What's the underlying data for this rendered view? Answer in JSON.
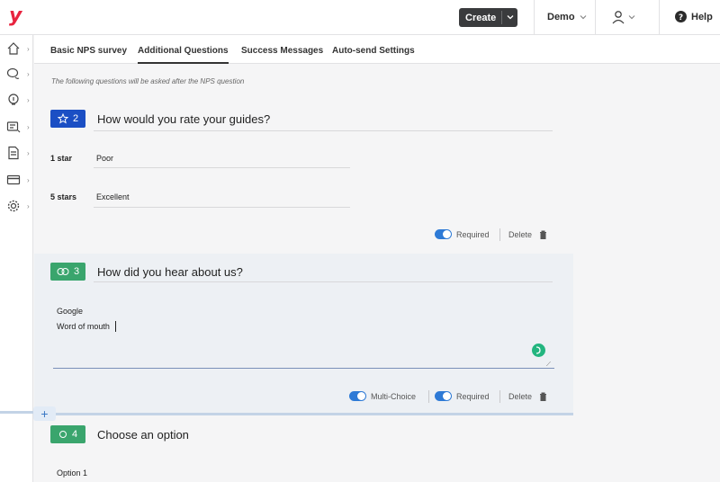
{
  "topbar": {
    "logo": "y",
    "create_label": "Create",
    "account_label": "Demo",
    "help_label": "Help"
  },
  "sidebar": {
    "items": [
      {
        "icon": "home-icon"
      },
      {
        "icon": "chat-icon"
      },
      {
        "icon": "lightbulb-icon"
      },
      {
        "icon": "message-list-icon"
      },
      {
        "icon": "document-icon"
      },
      {
        "icon": "card-icon"
      },
      {
        "icon": "gear-icon"
      }
    ]
  },
  "tabs": [
    {
      "label": "Basic NPS survey",
      "active": false
    },
    {
      "label": "Additional Questions",
      "active": true
    },
    {
      "label": "Success Messages",
      "active": false
    },
    {
      "label": "Auto-send Settings",
      "active": false
    }
  ],
  "note": "The following questions will be asked after the NPS question",
  "questions": [
    {
      "number": "2",
      "icon": "star-icon",
      "color": "#1b4fc4",
      "title": "How would you rate your guides?",
      "rows": [
        {
          "label": "1 star",
          "value": "Poor"
        },
        {
          "label": "5 stars",
          "value": "Excellent"
        }
      ],
      "required_label": "Required",
      "delete_label": "Delete"
    },
    {
      "number": "3",
      "icon": "multi-choice-icon",
      "color": "#3aa56d",
      "title": "How did you hear about us?",
      "options": [
        "Google",
        "Word of mouth"
      ],
      "multi_choice_label": "Multi-Choice",
      "required_label": "Required",
      "delete_label": "Delete"
    },
    {
      "number": "4",
      "icon": "radio-icon",
      "color": "#3aa56d",
      "title": "Choose an option",
      "options": [
        "Option 1"
      ]
    }
  ]
}
